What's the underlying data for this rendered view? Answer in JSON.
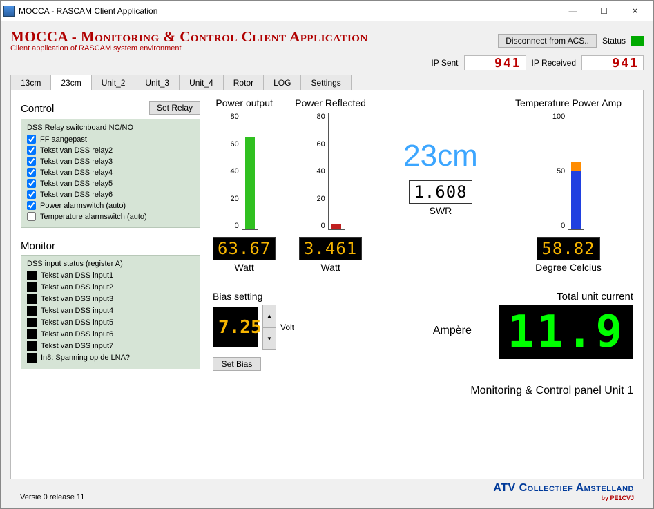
{
  "window": {
    "title": "MOCCA - RASCAM Client Application"
  },
  "header": {
    "title": "MOCCA - Monitoring & Control Client Application",
    "subtitle": "Client application of RASCAM system environment",
    "disconnect_btn": "Disconnect from ACS..",
    "status_label": "Status"
  },
  "ip": {
    "sent_label": "IP Sent",
    "sent_value": "941",
    "recv_label": "IP Received",
    "recv_value": "941"
  },
  "tabs": [
    "13cm",
    "23cm",
    "Unit_2",
    "Unit_3",
    "Unit_4",
    "Rotor",
    "LOG",
    "Settings"
  ],
  "active_tab_index": 1,
  "control": {
    "title": "Control",
    "set_relay_btn": "Set Relay",
    "panel_title": "DSS Relay switchboard NC/NO",
    "items": [
      {
        "label": "FF aangepast",
        "checked": true
      },
      {
        "label": "Tekst van DSS relay2",
        "checked": true
      },
      {
        "label": "Tekst van DSS relay3",
        "checked": true
      },
      {
        "label": "Tekst van DSS relay4",
        "checked": true
      },
      {
        "label": "Tekst van DSS relay5",
        "checked": true
      },
      {
        "label": "Tekst van DSS relay6",
        "checked": true
      },
      {
        "label": "Power alarmswitch (auto)",
        "checked": true
      },
      {
        "label": "Temperature alarmswitch (auto)",
        "checked": false
      }
    ]
  },
  "monitor": {
    "title": "Monitor",
    "panel_title": "DSS input status (register A)",
    "items": [
      "Tekst van DSS input1",
      "Tekst van DSS input2",
      "Tekst van DSS input3",
      "Tekst van DSS input4",
      "Tekst van DSS input5",
      "Tekst van DSS input6",
      "Tekst van DSS input7",
      "In8: Spanning op de LNA?"
    ]
  },
  "gauges": {
    "power_out": {
      "title": "Power output",
      "ticks": [
        "80",
        "60",
        "40",
        "20",
        "0"
      ],
      "bar_percent": 79,
      "bar_color": "#30c020",
      "lcd": "63.67",
      "unit": "Watt"
    },
    "power_refl": {
      "title": "Power Reflected",
      "ticks": [
        "80",
        "60",
        "40",
        "20",
        "0"
      ],
      "bar_percent": 4,
      "bar_color": "#c02020",
      "lcd": "3.461",
      "unit": "Watt"
    },
    "swr": {
      "lcd": "1.608",
      "unit": "SWR"
    },
    "temp": {
      "title": "Temperature Power Amp",
      "ticks": [
        "100",
        "50",
        "0"
      ],
      "blue_percent": 50,
      "orange_bottom": 50,
      "orange_height": 8,
      "lcd": "58.82",
      "unit": "Degree Celcius"
    }
  },
  "center_label": "23cm",
  "bias": {
    "title": "Bias setting",
    "value": "7.25",
    "unit": "Volt",
    "set_btn": "Set Bias"
  },
  "total_current": {
    "title": "Total unit current",
    "unit": "Ampère",
    "value": "11.9"
  },
  "panel_caption": "Monitoring & Control panel Unit 1",
  "footer": {
    "version": "Versie 0 release 11",
    "brand": "ATV Collectief Amstelland",
    "by": "by PE1CVJ"
  },
  "chart_data": [
    {
      "type": "bar",
      "title": "Power output",
      "categories": [
        "value"
      ],
      "values": [
        63.67
      ],
      "ylabel": "Watt",
      "ylim": [
        0,
        80
      ]
    },
    {
      "type": "bar",
      "title": "Power Reflected",
      "categories": [
        "value"
      ],
      "values": [
        3.461
      ],
      "ylabel": "Watt",
      "ylim": [
        0,
        80
      ]
    },
    {
      "type": "bar",
      "title": "Temperature Power Amp",
      "categories": [
        "value"
      ],
      "values": [
        58.82
      ],
      "ylabel": "Degree Celcius",
      "ylim": [
        0,
        100
      ]
    }
  ]
}
